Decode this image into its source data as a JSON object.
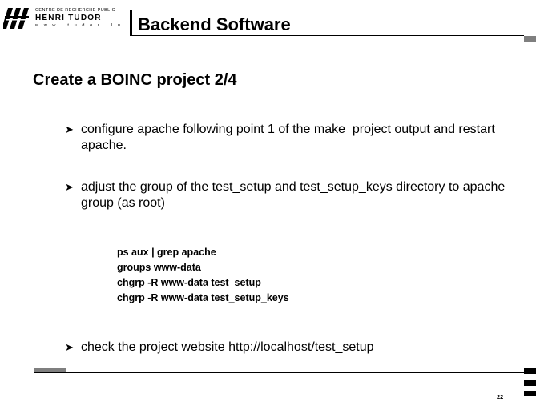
{
  "logo": {
    "line1": "CENTRE DE RECHERCHE PUBLIC",
    "name": "HENRI TUDOR",
    "url": "w w w . t u d o r . l u"
  },
  "header": {
    "title": "Backend Software"
  },
  "slide": {
    "title": "Create a BOINC project 2/4",
    "bullets": [
      "configure apache following point 1 of the make_project output and restart apache.",
      "adjust the group of the test_setup and test_setup_keys directory to apache group (as root)",
      "check the project website http://localhost/test_setup"
    ],
    "code_lines": [
      "ps aux | grep apache",
      "groups www-data",
      "chgrp -R www-data test_setup",
      "chgrp -R www-data test_setup_keys"
    ]
  },
  "footer": {
    "page_number": "22"
  }
}
